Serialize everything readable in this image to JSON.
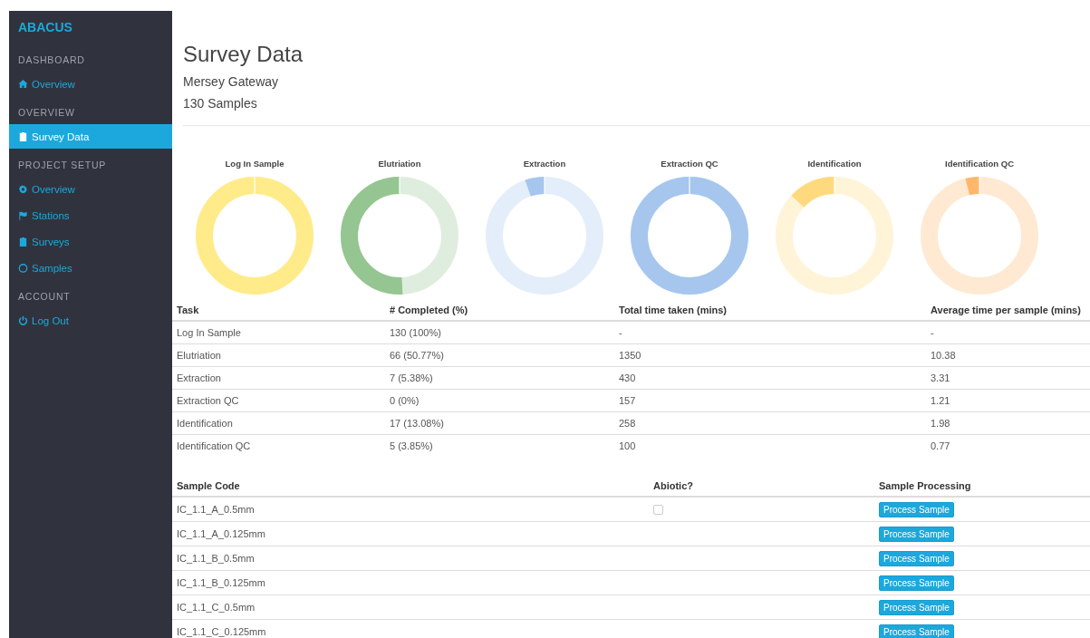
{
  "sidebar": {
    "brand": "ABACUS",
    "sections": [
      {
        "heading": "DASHBOARD",
        "items": [
          {
            "label": "Overview",
            "selected": false
          }
        ]
      },
      {
        "heading": "OVERVIEW",
        "items": [
          {
            "label": "Survey Data",
            "selected": true
          }
        ]
      },
      {
        "heading": "PROJECT SETUP",
        "items": [
          {
            "label": "Overview",
            "selected": false
          },
          {
            "label": "Stations",
            "selected": false
          },
          {
            "label": "Surveys",
            "selected": false
          },
          {
            "label": "Samples",
            "selected": false
          }
        ]
      },
      {
        "heading": "ACCOUNT",
        "items": [
          {
            "label": "Log Out",
            "selected": false
          }
        ]
      }
    ]
  },
  "header": {
    "title": "Survey Data",
    "project": "Mersey Gateway",
    "samples": "130 Samples"
  },
  "charts": [
    {
      "title": "Log In Sample",
      "color": "#ffeb8a"
    },
    {
      "title": "Elutriation",
      "color": "#95c591"
    },
    {
      "title": "Extraction",
      "color": "#a6c6ee"
    },
    {
      "title": "Extraction QC",
      "color": "#a6c6ee"
    },
    {
      "title": "Identification",
      "color": "#ffd97e"
    },
    {
      "title": "Identification QC",
      "color": "#ffb76b"
    }
  ],
  "task_table": {
    "columns": [
      "Task",
      "# Completed (%)",
      "Total time taken (mins)",
      "Average time per sample (mins)"
    ],
    "rows": [
      [
        "Log In Sample",
        "130 (100%)",
        "-",
        "-"
      ],
      [
        "Elutriation",
        "66 (50.77%)",
        "1350",
        "10.38"
      ],
      [
        "Extraction",
        "7 (5.38%)",
        "430",
        "3.31"
      ],
      [
        "Extraction QC",
        "0 (0%)",
        "157",
        "1.21"
      ],
      [
        "Identification",
        "17 (13.08%)",
        "258",
        "1.98"
      ],
      [
        "Identification QC",
        "5 (3.85%)",
        "100",
        "0.77"
      ]
    ]
  },
  "sample_table": {
    "columns": [
      "Sample Code",
      "Abiotic?",
      "Sample Processing"
    ],
    "rows": [
      {
        "code": "IC_1.1_A_0.5mm",
        "kind": "checkbox",
        "checked": false,
        "action": "Process Sample"
      },
      {
        "code": "IC_1.1_A_0.125mm",
        "kind": "plain",
        "action": "Process Sample"
      },
      {
        "code": "IC_1.1_B_0.5mm",
        "kind": "plain",
        "action": "Process Sample"
      },
      {
        "code": "IC_1.1_B_0.125mm",
        "kind": "plain",
        "action": "Process Sample"
      },
      {
        "code": "IC_1.1_C_0.5mm",
        "kind": "plain",
        "action": "Process Sample"
      },
      {
        "code": "IC_1.1_C_0.125mm",
        "kind": "plain",
        "action": "Process Sample"
      }
    ]
  }
}
